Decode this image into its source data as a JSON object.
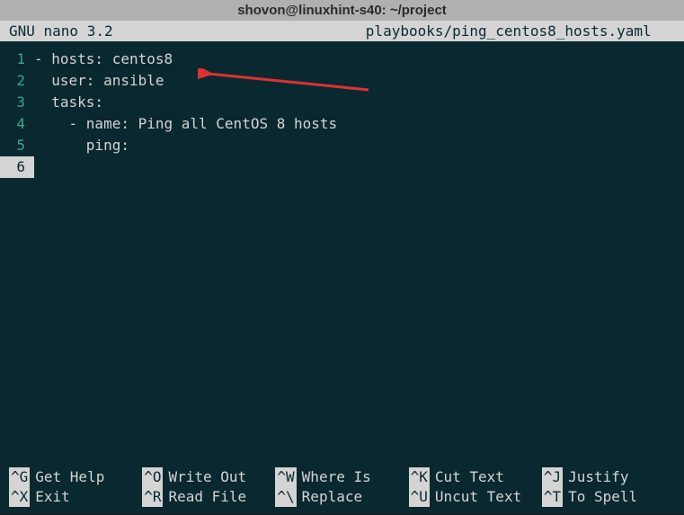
{
  "title": "shovon@linuxhint-s40: ~/project",
  "header": {
    "app": "GNU nano 3.2",
    "file": "playbooks/ping_centos8_hosts.yaml"
  },
  "lines": [
    {
      "no": "1",
      "text": "- hosts: centos8"
    },
    {
      "no": "2",
      "text": "  user: ansible"
    },
    {
      "no": "3",
      "text": "  tasks:"
    },
    {
      "no": "4",
      "text": "    - name: Ping all CentOS 8 hosts"
    },
    {
      "no": "5",
      "text": "      ping:"
    },
    {
      "no": "6",
      "text": ""
    }
  ],
  "shortcuts": {
    "row1": [
      {
        "key": "^G",
        "label": "Get Help"
      },
      {
        "key": "^O",
        "label": "Write Out"
      },
      {
        "key": "^W",
        "label": "Where Is"
      },
      {
        "key": "^K",
        "label": "Cut Text"
      },
      {
        "key": "^J",
        "label": "Justify"
      }
    ],
    "row2": [
      {
        "key": "^X",
        "label": "Exit"
      },
      {
        "key": "^R",
        "label": "Read File"
      },
      {
        "key": "^\\",
        "label": "Replace"
      },
      {
        "key": "^U",
        "label": "Uncut Text"
      },
      {
        "key": "^T",
        "label": "To Spell"
      }
    ]
  }
}
